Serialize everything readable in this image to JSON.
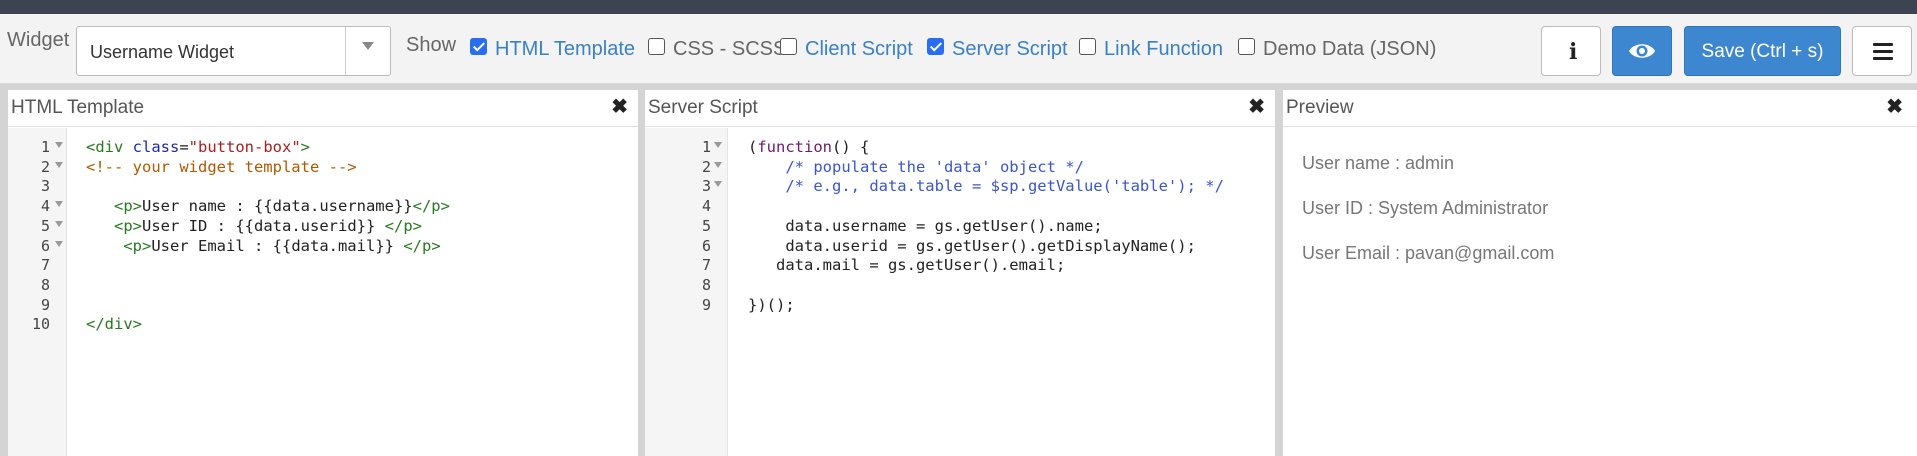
{
  "toolbar": {
    "widget_label": "Widget",
    "widget_value": "Username Widget",
    "show_label": "Show",
    "toggles": [
      {
        "label": "HTML Template",
        "checked": true
      },
      {
        "label": "CSS - SCSS",
        "checked": false
      },
      {
        "label": "Client Script",
        "checked": false
      },
      {
        "label": "Server Script",
        "checked": true
      },
      {
        "label": "Link Function",
        "checked": false
      },
      {
        "label": "Demo Data (JSON)",
        "checked": false
      }
    ],
    "save_label": "Save (Ctrl + s)",
    "icons": {
      "info": "info-icon",
      "preview": "eye-icon",
      "menu": "hamburger-menu-icon"
    }
  },
  "html_panel": {
    "title": "HTML Template",
    "lines": [
      "<div class=\"button-box\">",
      "<!-- your widget template -->",
      "",
      "   <p>User name : {{data.username}}</p>",
      "   <p>User ID : {{data.userid}} </p>",
      "    <p>User Email : {{data.mail}} </p>",
      "",
      "",
      "",
      "</div>"
    ]
  },
  "server_panel": {
    "title": "Server Script",
    "lines": [
      "(function() {",
      "    /* populate the 'data' object */",
      "    /* e.g., data.table = $sp.getValue('table'); */",
      "",
      "    data.username = gs.getUser().name;",
      "    data.userid = gs.getUser().getDisplayName();",
      "   data.mail = gs.getUser().email;",
      "",
      "})();"
    ]
  },
  "preview_panel": {
    "title": "Preview",
    "lines": [
      "User name : admin",
      "User ID : System Administrator",
      "User Email : pavan@gmail.com"
    ]
  },
  "colors": {
    "accent": "#3d87d1",
    "link": "#3a80c4",
    "top_bar": "#3c4452"
  }
}
